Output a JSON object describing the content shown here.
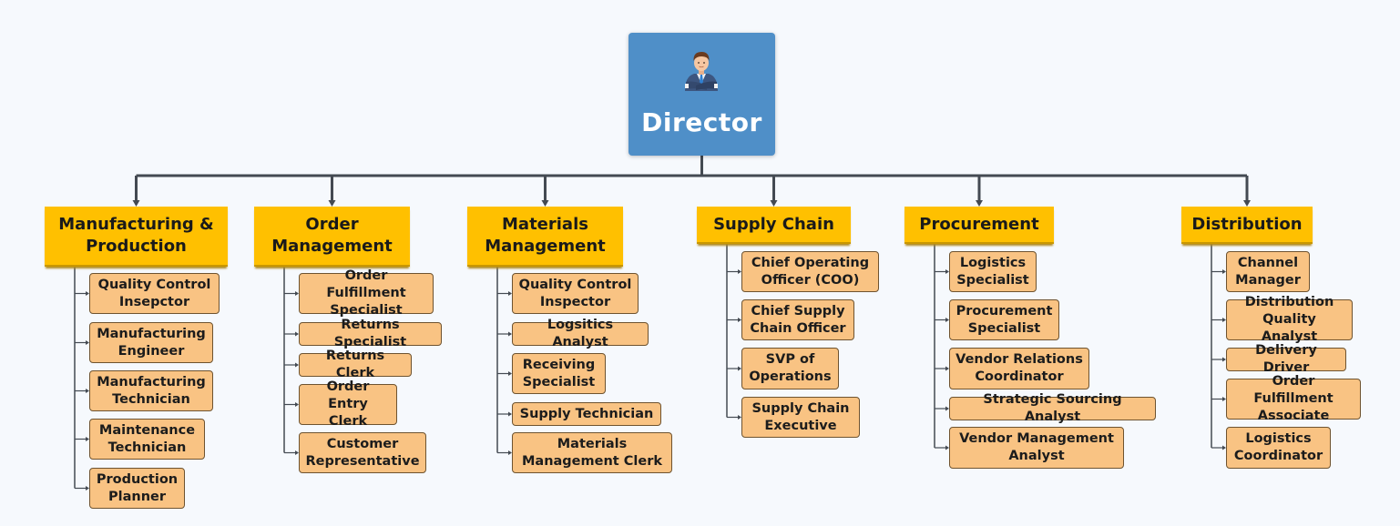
{
  "director": {
    "title": "Director",
    "icon": "businessman-icon"
  },
  "colors": {
    "background": "#f6f9fd",
    "director_fill": "#4f8fc8",
    "department_fill": "#ffc000",
    "role_fill": "#f9c383",
    "role_border": "#6e5330",
    "connector": "#444a52"
  },
  "departments": [
    {
      "name": "Manufacturing &\nProduction",
      "roles": [
        "Quality Control\nInsepctor",
        "Manufacturing\nEngineer",
        "Manufacturing\nTechnician",
        "Maintenance\nTechnician",
        "Production\nPlanner"
      ]
    },
    {
      "name": "Order\nManagement",
      "roles": [
        "Order Fulfillment\nSpecialist",
        "Returns Specialist",
        "Returns Clerk",
        "Order Entry\nClerk",
        "Customer\nRepresentative"
      ]
    },
    {
      "name": "Materials\nManagement",
      "roles": [
        "Quality Control\nInspector",
        "Logsitics Analyst",
        "Receiving\nSpecialist",
        "Supply Technician",
        "Materials\nManagement Clerk"
      ]
    },
    {
      "name": "Supply Chain",
      "roles": [
        "Chief Operating\nOfficer (COO)",
        "Chief Supply\nChain Officer",
        "SVP of\nOperations",
        "Supply Chain\nExecutive"
      ]
    },
    {
      "name": "Procurement",
      "roles": [
        "Logistics\nSpecialist",
        "Procurement\nSpecialist",
        "Vendor Relations\nCoordinator",
        "Strategic Sourcing Analyst",
        "Vendor Management\nAnalyst"
      ]
    },
    {
      "name": "Distribution",
      "roles": [
        "Channel\nManager",
        "Distribution\nQuality Analyst",
        "Delivery Driver",
        "Order Fulfillment\nAssociate",
        "Logistics\nCoordinator"
      ]
    }
  ]
}
